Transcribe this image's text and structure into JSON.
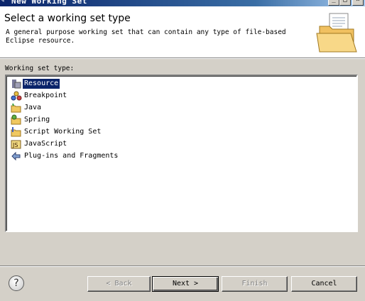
{
  "window": {
    "title": "New Working Set",
    "controls": [
      "_",
      "□",
      "×"
    ]
  },
  "header": {
    "heading": "Select a working set type",
    "description": "A general purpose working set that can contain any type of file-based Eclipse resource.",
    "image_icon": "folder-document-icon"
  },
  "list": {
    "label": "Working set type:",
    "items": [
      {
        "label": "Resource",
        "icon": "resource-icon",
        "selected": true
      },
      {
        "label": "Breakpoint",
        "icon": "breakpoint-icon",
        "selected": false
      },
      {
        "label": "Java",
        "icon": "java-folder-icon",
        "selected": false
      },
      {
        "label": "Spring",
        "icon": "spring-folder-icon",
        "selected": false
      },
      {
        "label": "Script Working Set",
        "icon": "script-folder-icon",
        "selected": false
      },
      {
        "label": "JavaScript",
        "icon": "javascript-icon",
        "selected": false
      },
      {
        "label": "Plug-ins and Fragments",
        "icon": "plugin-icon",
        "selected": false
      }
    ]
  },
  "footer": {
    "help_symbol": "?",
    "back_label": "< Back",
    "next_label": "Next >",
    "finish_label": "Finish",
    "cancel_label": "Cancel"
  },
  "colors": {
    "selection": "#0a246a",
    "dialog_bg": "#d4d0c8"
  }
}
